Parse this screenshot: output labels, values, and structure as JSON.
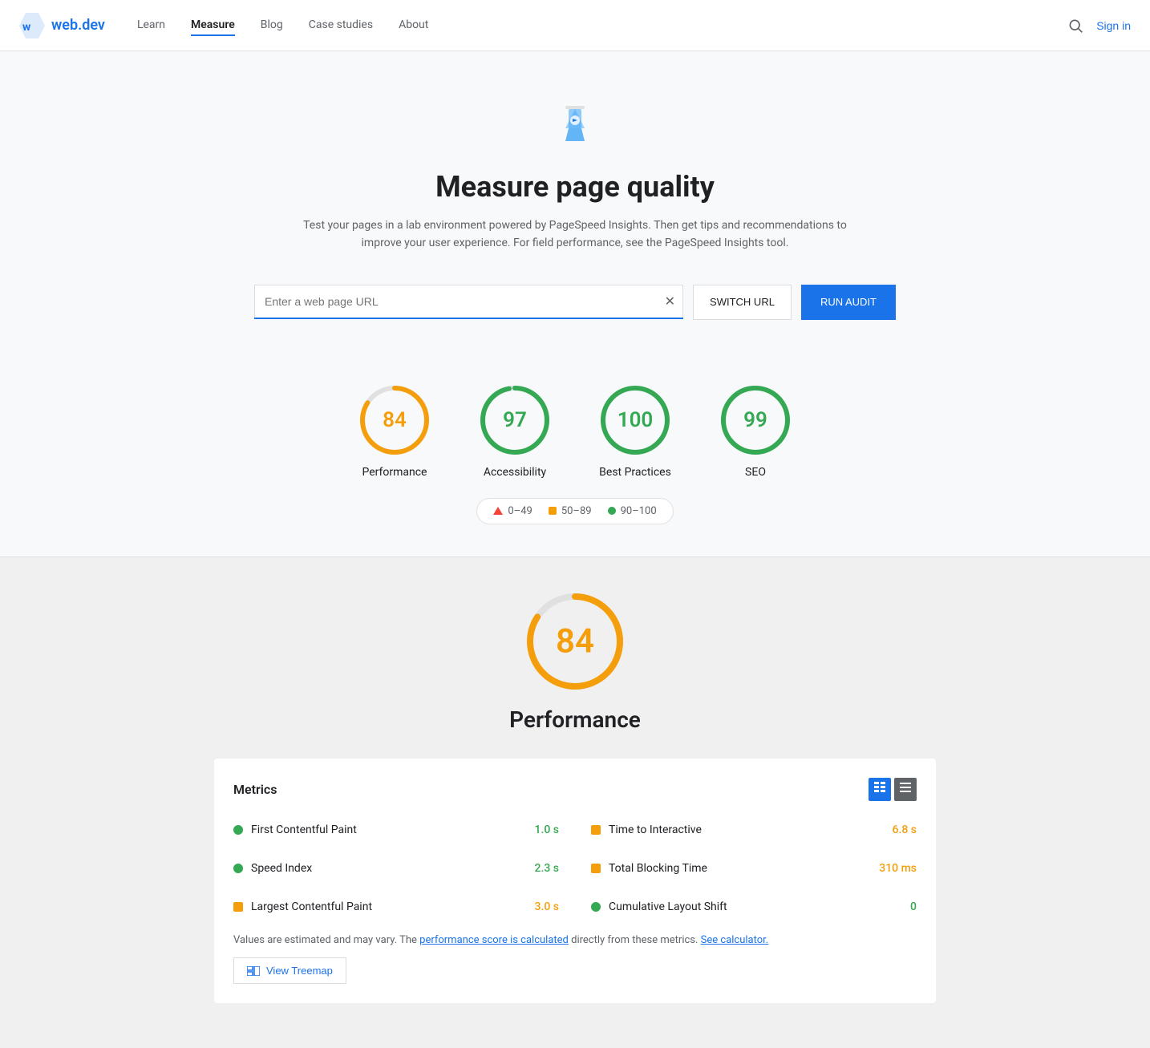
{
  "nav": {
    "logo_text": "web.dev",
    "links": [
      {
        "id": "learn",
        "label": "Learn",
        "active": false
      },
      {
        "id": "measure",
        "label": "Measure",
        "active": true
      },
      {
        "id": "blog",
        "label": "Blog",
        "active": false
      },
      {
        "id": "case-studies",
        "label": "Case studies",
        "active": false
      },
      {
        "id": "about",
        "label": "About",
        "active": false
      }
    ],
    "sign_in": "Sign in"
  },
  "hero": {
    "title": "Measure page quality",
    "description": "Test your pages in a lab environment powered by PageSpeed Insights. Then get tips and recommendations to improve your user experience. For field performance, see the PageSpeed Insights tool.",
    "url_placeholder": "Enter a web page URL",
    "switch_url_label": "SWITCH URL",
    "run_audit_label": "RUN AUDIT"
  },
  "scores": [
    {
      "id": "performance",
      "value": 84,
      "label": "Performance",
      "color": "#f59e0b",
      "pct": 84
    },
    {
      "id": "accessibility",
      "value": 97,
      "label": "Accessibility",
      "color": "#34a853",
      "pct": 97
    },
    {
      "id": "best-practices",
      "value": 100,
      "label": "Best Practices",
      "color": "#34a853",
      "pct": 100
    },
    {
      "id": "seo",
      "value": 99,
      "label": "SEO",
      "color": "#34a853",
      "pct": 99
    }
  ],
  "legend": {
    "items": [
      {
        "id": "fail",
        "range": "0–49",
        "type": "triangle",
        "color": "#f44336"
      },
      {
        "id": "average",
        "range": "50–89",
        "type": "square",
        "color": "#f59e0b"
      },
      {
        "id": "pass",
        "range": "90–100",
        "type": "circle",
        "color": "#34a853"
      }
    ]
  },
  "performance_detail": {
    "score": 84,
    "title": "Performance",
    "metrics_title": "Metrics",
    "metrics": [
      {
        "id": "fcp",
        "name": "First Contentful Paint",
        "value": "1.0 s",
        "color_class": "dot-green",
        "shape": "circle",
        "value_color": "green"
      },
      {
        "id": "tti",
        "name": "Time to Interactive",
        "value": "6.8 s",
        "color_class": "dot-orange",
        "shape": "square",
        "value_color": "orange"
      },
      {
        "id": "si",
        "name": "Speed Index",
        "value": "2.3 s",
        "color_class": "dot-green",
        "shape": "circle",
        "value_color": "green"
      },
      {
        "id": "tbt",
        "name": "Total Blocking Time",
        "value": "310 ms",
        "color_class": "dot-orange",
        "shape": "square",
        "value_color": "orange"
      },
      {
        "id": "lcp",
        "name": "Largest Contentful Paint",
        "value": "3.0 s",
        "color_class": "dot-orange",
        "shape": "square",
        "value_color": "orange"
      },
      {
        "id": "cls",
        "name": "Cumulative Layout Shift",
        "value": "0",
        "color_class": "dot-green",
        "shape": "circle",
        "value_color": "green"
      }
    ],
    "note_text": "Values are estimated and may vary. The ",
    "note_link1": "performance score is calculated",
    "note_middle": " directly from these metrics. ",
    "note_link2": "See calculator.",
    "view_treemap_label": "View Treemap"
  }
}
